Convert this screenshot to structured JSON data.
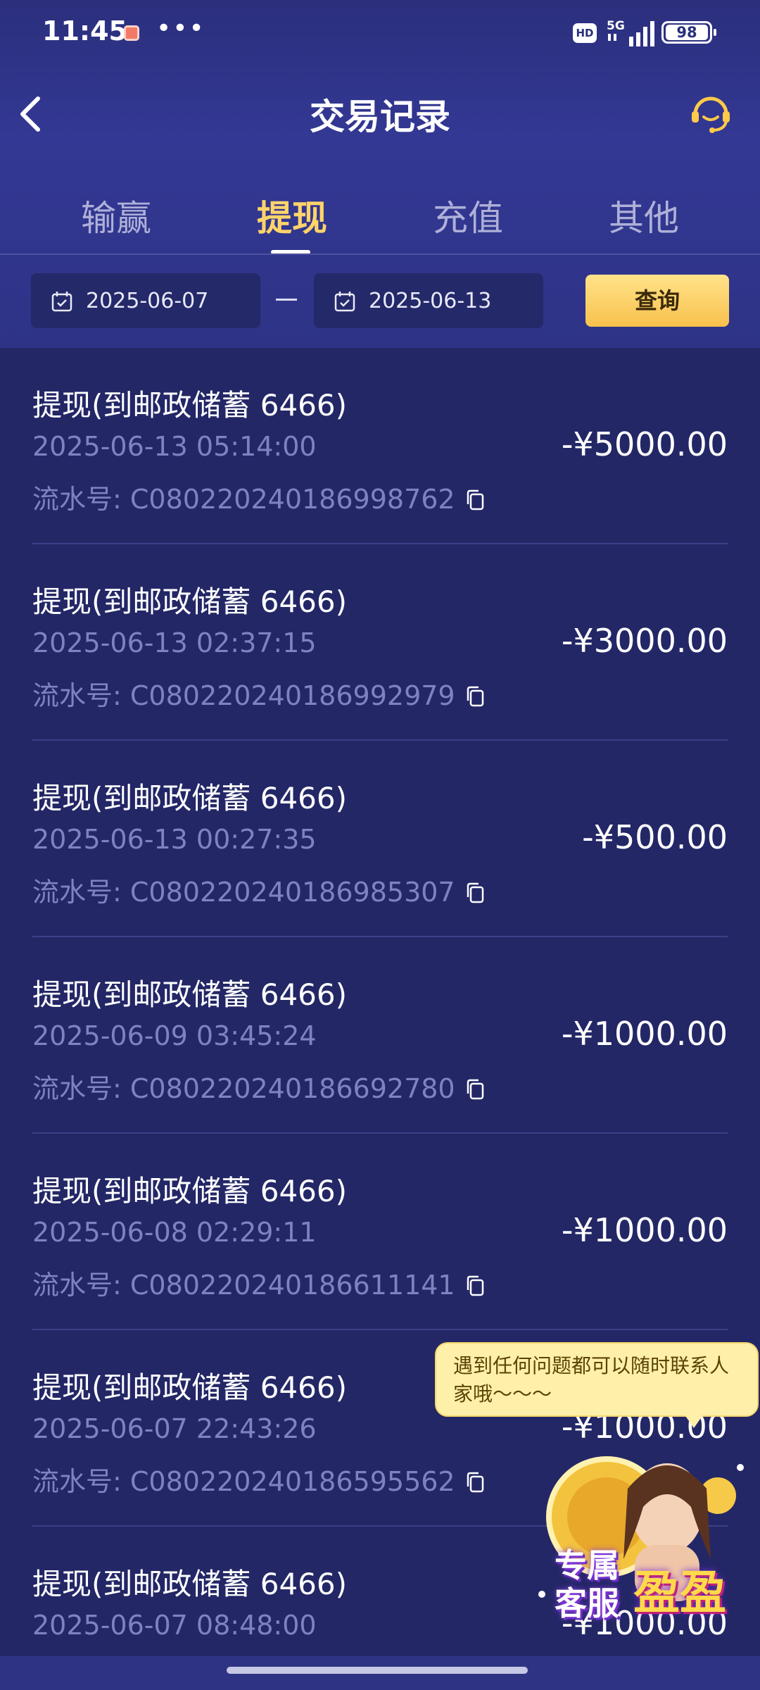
{
  "status_bar": {
    "time": "11:45",
    "more": "•••",
    "hd": "HD",
    "network": "5G",
    "battery": "98"
  },
  "header": {
    "title": "交易记录"
  },
  "tabs": [
    {
      "label": "输赢",
      "active": false
    },
    {
      "label": "提现",
      "active": true
    },
    {
      "label": "充值",
      "active": false
    },
    {
      "label": "其他",
      "active": false
    }
  ],
  "filter": {
    "start_date": "2025-06-07",
    "end_date": "2025-06-13",
    "query_label": "查询"
  },
  "records": [
    {
      "name": "提现(到邮政储蓄 6466)",
      "date": "2025-06-13 05:14:00",
      "serial": "流水号: C08022024018699876​2",
      "amount": "-¥5000.00"
    },
    {
      "name": "提现(到邮政储蓄 6466)",
      "date": "2025-06-13 02:37:15",
      "serial": "流水号: C080220240186992979",
      "amount": "-¥3000.00"
    },
    {
      "name": "提现(到邮政储蓄 6466)",
      "date": "2025-06-13 00:27:35",
      "serial": "流水号: C080220240186985307",
      "amount": "-¥500.00"
    },
    {
      "name": "提现(到邮政储蓄 6466)",
      "date": "2025-06-09 03:45:24",
      "serial": "流水号: C080220240186692780",
      "amount": "-¥1000.00"
    },
    {
      "name": "提现(到邮政储蓄 6466)",
      "date": "2025-06-08 02:29:11",
      "serial": "流水号: C080220240186611141",
      "amount": "-¥1000.00"
    },
    {
      "name": "提现(到邮政储蓄 6466)",
      "date": "2025-06-07 22:43:26",
      "serial": "流水号: C080220240186595562",
      "amount": "-¥1000.00"
    },
    {
      "name": "提现(到邮政储蓄 6466)",
      "date": "2025-06-07 08:48:00",
      "serial": "",
      "amount": "-¥1000.00"
    }
  ],
  "service": {
    "bubble": "遇到任何问题都可以随时联系人家哦～～～",
    "label_line1": "专属",
    "label_line2": "客服",
    "name": "盈盈"
  },
  "colors": {
    "accent": "#ffd46a",
    "background": "#232766",
    "button": "#f9c14d"
  }
}
